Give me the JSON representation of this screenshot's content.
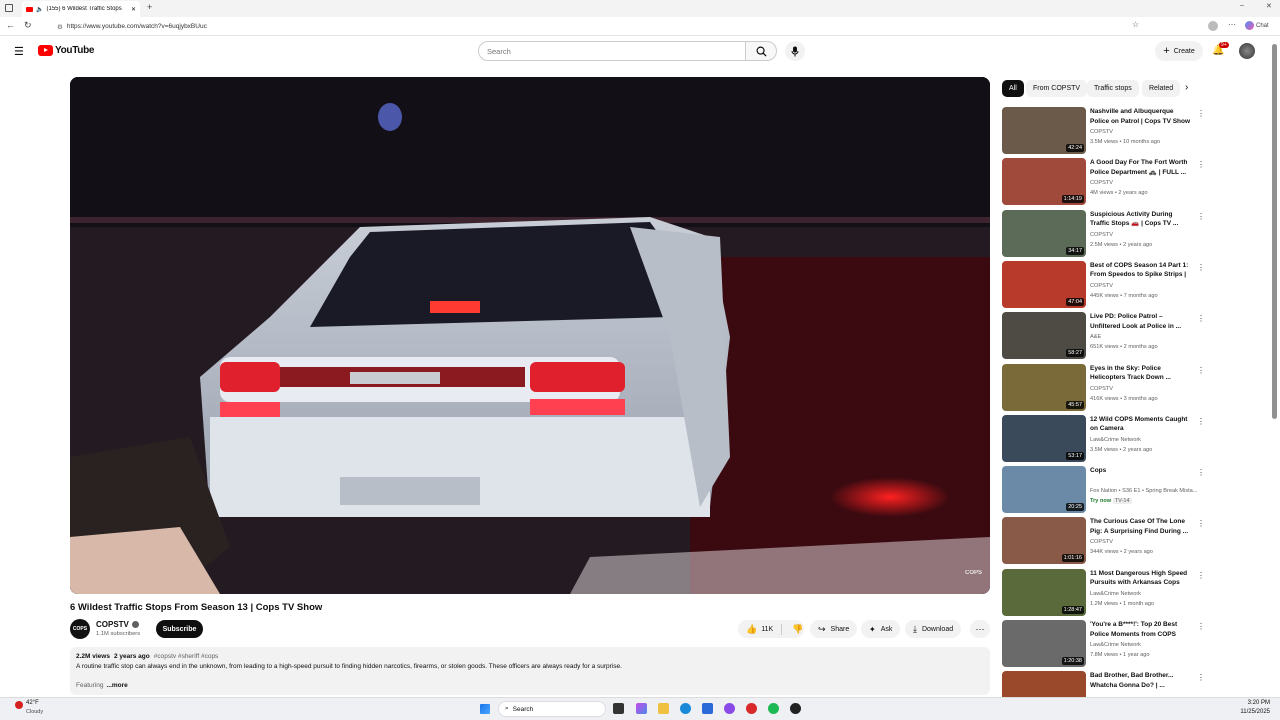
{
  "browser": {
    "tab_title": "(155) 6 Wildest Traffic Stops",
    "url": "https://www.youtube.com/watch?v=6uqjybxBUuc",
    "chat_label": "Chat"
  },
  "youtube": {
    "logo_text": "YouTube",
    "search_placeholder": "Search",
    "create_label": "Create",
    "notif_count": "9+"
  },
  "video": {
    "title": "6 Wildest Traffic Stops From Season 13 | Cops TV Show",
    "channel": "COPSTV",
    "subscribers": "1.1M subscribers",
    "subscribe_label": "Subscribe",
    "likes": "11K",
    "share_label": "Share",
    "ask_label": "Ask",
    "download_label": "Download",
    "views": "2.2M views",
    "age": "2 years ago",
    "tags": "#copstv #sheriff #cops",
    "description": "A routine traffic stop can always end in the unknown, from leading to a high-speed pursuit to finding hidden narcotics, firearms, or stolen goods. These officers are always ready for a surprise.",
    "featuring": "Featuring",
    "more": "...more",
    "watermark": "COPS"
  },
  "chips": [
    "All",
    "From COPSTV",
    "Traffic stops",
    "Related"
  ],
  "recommendations": [
    {
      "title": "Nashville and Albuquerque Police on Patrol | Cops TV Show",
      "channel": "COPSTV",
      "meta": "3.5M views • 10 months ago",
      "duration": "42:24",
      "color": "#6b5a4a"
    },
    {
      "title": "A Good Day For The Fort Worth Police Department 🚓 | FULL ...",
      "channel": "COPSTV",
      "meta": "4M views • 2 years ago",
      "duration": "1:14:19",
      "color": "#a04a3c"
    },
    {
      "title": "Suspicious Activity During Traffic Stops 🚗 | Cops TV ...",
      "channel": "COPSTV",
      "meta": "2.5M views • 2 years ago",
      "duration": "34:17",
      "color": "#5c6a58"
    },
    {
      "title": "Best of COPS Season 14 Part 1: From Speedos to Spike Strips | ...",
      "channel": "COPSTV",
      "meta": "445K views • 7 months ago",
      "duration": "47:04",
      "color": "#b83a2a"
    },
    {
      "title": "Live PD: Police Patrol – Unfiltered Look at Police in ...",
      "channel": "A&E",
      "meta": "651K views • 2 months ago",
      "duration": "58:27",
      "color": "#4e4a44"
    },
    {
      "title": "Eyes in the Sky: Police Helicopters Track Down ...",
      "channel": "COPSTV",
      "meta": "416K views • 3 months ago",
      "duration": "45:57",
      "color": "#7a6a3a"
    },
    {
      "title": "12 Wild COPS Moments Caught on Camera",
      "channel": "Law&Crime Network",
      "meta": "3.5M views • 2 years ago",
      "duration": "53:17",
      "color": "#3a4a5a"
    },
    {
      "title": "Cops",
      "channel": "Fox Nation • S36 E1 • Spring Break Mista...",
      "meta": "Try now",
      "meta2": "TV-14",
      "duration": "20:25",
      "color": "#6a8aa8"
    },
    {
      "title": "The Curious Case Of The Lone Pig: A Surprising Find During ...",
      "channel": "COPSTV",
      "meta": "344K views • 2 years ago",
      "duration": "1:01:16",
      "color": "#8a5a48"
    },
    {
      "title": "11 Most Dangerous High Speed Pursuits with Arkansas Cops",
      "channel": "Law&Crime Network",
      "meta": "1.2M views • 1 month ago",
      "duration": "1:28:47",
      "color": "#5a6a3a"
    },
    {
      "title": "'You're a B****!': Top 20 Best Police Moments from COPS",
      "channel": "Law&Crime Network",
      "meta": "7.8M views • 1 year ago",
      "duration": "1:20:38",
      "color": "#6a6a6a"
    },
    {
      "title": "Bad Brother, Bad Brother... Whatcha Gonna Do? | ...",
      "channel": "",
      "meta": "",
      "duration": "",
      "color": "#9a4a2a"
    }
  ],
  "taskbar": {
    "weather_temp": "42°F",
    "weather_desc": "Cloudy",
    "search": "Search",
    "time": "3:20 PM",
    "date": "11/25/2025"
  }
}
